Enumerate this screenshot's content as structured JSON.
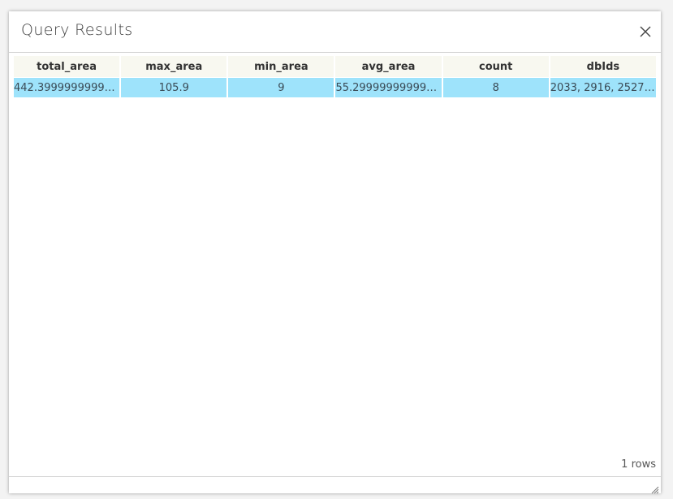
{
  "dialog": {
    "title": "Query Results",
    "close_icon": "close-icon",
    "resize_icon": "resize-grip-icon"
  },
  "table": {
    "columns": [
      "total_area",
      "max_area",
      "min_area",
      "avg_area",
      "count",
      "dbIds"
    ],
    "rows": [
      [
        "442.39999999999998",
        "105.9",
        "9",
        "55.299999999999997",
        "8",
        "2033, 2916, 2527, 2..."
      ]
    ]
  },
  "footer": {
    "rows_count": "1 rows"
  },
  "colors": {
    "header_bg": "#f8f8f0",
    "selected_row_bg": "#9ee3fb"
  }
}
